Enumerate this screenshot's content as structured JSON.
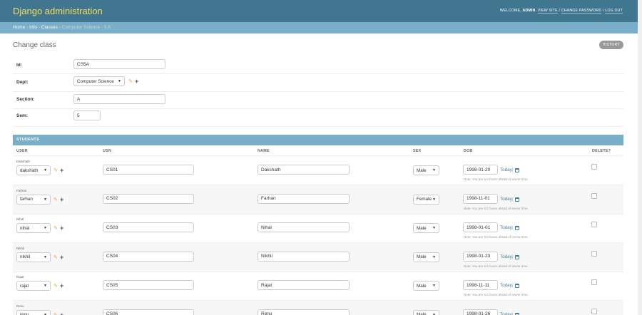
{
  "header": {
    "site_name": "Django administration",
    "welcome": "Welcome,",
    "username": "admin",
    "sep": ".",
    "view_site": "View site",
    "slash": "/",
    "change_password": "Change password",
    "log_out": "Log out"
  },
  "breadcrumbs": {
    "home": "Home",
    "info": "Info",
    "classes": "Classes",
    "current": "Computer Science - 5 A",
    "separator": "›"
  },
  "page": {
    "title": "Change class",
    "history": "History"
  },
  "form": {
    "id_label": "Id:",
    "id_value": "CS5A",
    "dept_label": "Dept:",
    "dept_value": "Computer Science",
    "section_label": "Section:",
    "section_value": "A",
    "sem_label": "Sem:",
    "sem_value": "5"
  },
  "students": {
    "title": "Students",
    "columns": {
      "user": "User",
      "usn": "USN",
      "name": "Name",
      "sex": "Sex",
      "dob": "DOB",
      "delete": "Delete?"
    },
    "today_label": "Today",
    "today_sep": "|",
    "note": "Note: You are 5.5 hours ahead of server time.",
    "rows": [
      {
        "original": "Dakshath",
        "user": "dakshath",
        "usn": "CS01",
        "name": "Dakshath",
        "sex": "Male",
        "dob": "1998-01-20"
      },
      {
        "original": "Farhan",
        "user": "farhan",
        "usn": "CS02",
        "name": "Farhan",
        "sex": "Female",
        "dob": "1998-11-01"
      },
      {
        "original": "Nihal",
        "user": "nihal",
        "usn": "CS03",
        "name": "Nihal",
        "sex": "Male",
        "dob": "1998-01-01"
      },
      {
        "original": "Nikhil",
        "user": "nikhil",
        "usn": "CS04",
        "name": "Nikhil",
        "sex": "Male",
        "dob": "1998-01-23"
      },
      {
        "original": "Rajat",
        "user": "rajat",
        "usn": "CS05",
        "name": "Rajat",
        "sex": "Male",
        "dob": "1998-11-11"
      },
      {
        "original": "Renu",
        "user": "renu",
        "usn": "CS06",
        "name": "Renu",
        "sex": "Male",
        "dob": "1998-01-26"
      }
    ]
  },
  "colors": {
    "header_bg": "#417690",
    "breadcrumb_bg": "#79aec8",
    "site_name": "#f5dd5d",
    "link": "#447e9b"
  }
}
